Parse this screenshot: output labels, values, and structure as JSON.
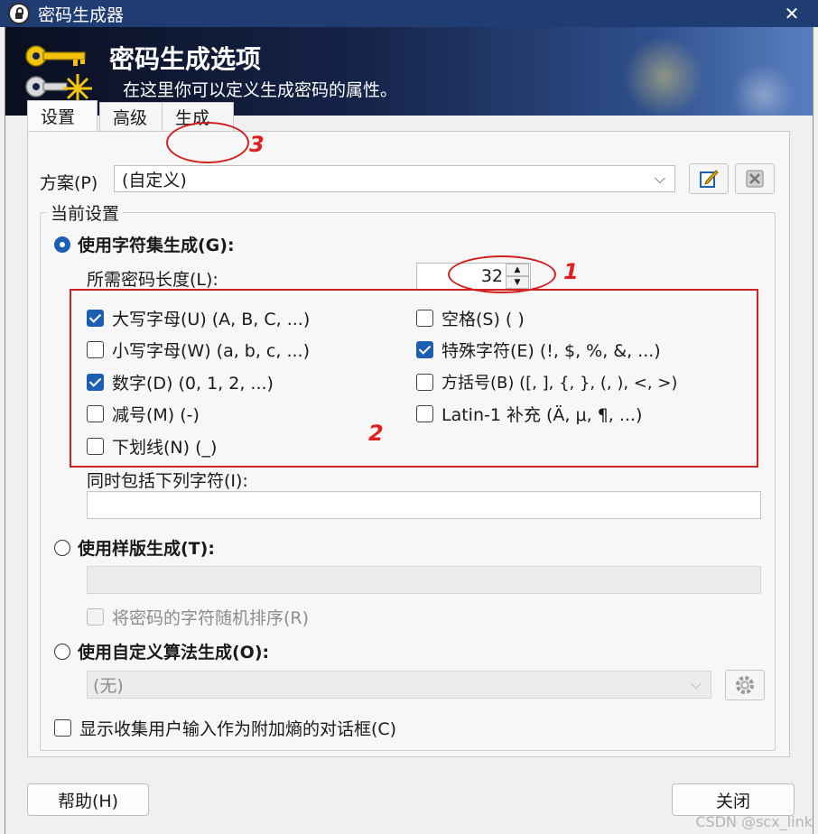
{
  "window": {
    "title": "密码生成器",
    "close_glyph": "✕"
  },
  "banner": {
    "title": "密码生成选项",
    "subtitle": "在这里你可以定义生成密码的属性。"
  },
  "tabs": [
    {
      "label": "设置",
      "active": true
    },
    {
      "label": "高级",
      "active": false
    },
    {
      "label": "生成",
      "active": false
    }
  ],
  "scheme": {
    "label": "方案(P)",
    "value": "(自定义)"
  },
  "current_settings": {
    "title": "当前设置",
    "charset_mode": {
      "label": "使用字符集生成(G):",
      "checked": true
    },
    "length_label": "所需密码长度(L):",
    "length_value": "32",
    "charsets_left": [
      {
        "label": "大写字母(U) (A, B, C, ...)",
        "checked": true
      },
      {
        "label": "小写字母(W) (a, b, c, ...)",
        "checked": false
      },
      {
        "label": "数字(D) (0, 1, 2, ...)",
        "checked": true
      },
      {
        "label": "减号(M) (-)",
        "checked": false
      },
      {
        "label": "下划线(N) (_)",
        "checked": false
      }
    ],
    "charsets_right": [
      {
        "label": "空格(S) ( )",
        "checked": false
      },
      {
        "label": "特殊字符(E) (!, $, %, &, ...)",
        "checked": true
      },
      {
        "label": "方括号(B) ([, ], {, }, (, ), <, >)",
        "checked": false
      },
      {
        "label": "Latin-1 补充 (Ä, μ, ¶, ...)",
        "checked": false
      }
    ],
    "include_label": "同时包括下列字符(I):",
    "include_value": "",
    "pattern_mode": {
      "label": "使用样版生成(T):",
      "checked": false
    },
    "pattern_value": "",
    "shuffle_label": "将密码的字符随机排序(R)",
    "custom_mode": {
      "label": "使用自定义算法生成(O):",
      "checked": false
    },
    "custom_value": "(无)",
    "entropy_label": "显示收集用户输入作为附加熵的对话框(C)"
  },
  "annotations": {
    "a1": "1",
    "a2": "2",
    "a3": "3"
  },
  "buttons": {
    "help": "帮助(H)",
    "close": "关闭"
  },
  "watermark": "CSDN @scx_link",
  "colors": {
    "accent": "#1b5fb3",
    "annotation": "#d32020",
    "titlebar": "#1f3c73"
  }
}
